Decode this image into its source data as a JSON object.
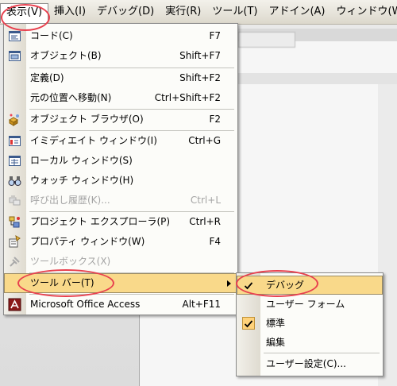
{
  "menubar": {
    "items": [
      {
        "label": "表示(V)"
      },
      {
        "label": "挿入(I)"
      },
      {
        "label": "デバッグ(D)"
      },
      {
        "label": "実行(R)"
      },
      {
        "label": "ツール(T)"
      },
      {
        "label": "アドイン(A)"
      },
      {
        "label": "ウィンドウ(W)"
      }
    ]
  },
  "view_menu": {
    "items": [
      {
        "label": "コード(C)",
        "shortcut": "F7",
        "icon": "code-window-icon"
      },
      {
        "label": "オブジェクト(B)",
        "shortcut": "Shift+F7",
        "icon": "object-window-icon"
      },
      {
        "label": "定義(D)",
        "shortcut": "Shift+F2"
      },
      {
        "label": "元の位置へ移動(N)",
        "shortcut": "Ctrl+Shift+F2"
      },
      {
        "label": "オブジェクト ブラウザ(O)",
        "shortcut": "F2",
        "icon": "object-browser-icon"
      },
      {
        "label": "イミディエイト ウィンドウ(I)",
        "shortcut": "Ctrl+G",
        "icon": "immediate-window-icon"
      },
      {
        "label": "ローカル ウィンドウ(S)",
        "shortcut": "",
        "icon": "locals-window-icon"
      },
      {
        "label": "ウォッチ ウィンドウ(H)",
        "shortcut": "",
        "icon": "watch-window-icon"
      },
      {
        "label": "呼び出し履歴(K)...",
        "shortcut": "Ctrl+L",
        "icon": "call-stack-icon"
      },
      {
        "label": "プロジェクト エクスプローラ(P)",
        "shortcut": "Ctrl+R",
        "icon": "project-explorer-icon"
      },
      {
        "label": "プロパティ ウィンドウ(W)",
        "shortcut": "F4",
        "icon": "properties-window-icon"
      },
      {
        "label": "ツールボックス(X)",
        "shortcut": "",
        "icon": "toolbox-icon"
      },
      {
        "label": "ツール バー(T)",
        "shortcut": ""
      },
      {
        "label": "Microsoft Office Access",
        "shortcut": "Alt+F11",
        "icon": "access-icon"
      }
    ]
  },
  "toolbar_submenu": {
    "items": [
      {
        "label": "デバッグ",
        "checked": true
      },
      {
        "label": "ユーザー フォーム",
        "checked": false
      },
      {
        "label": "標準",
        "checked": true
      },
      {
        "label": "編集",
        "checked": false
      },
      {
        "label": "ユーザー設定(C)...",
        "checked": false
      }
    ]
  },
  "colors": {
    "highlight": "#f9d98a",
    "annotation": "#e8404e"
  }
}
